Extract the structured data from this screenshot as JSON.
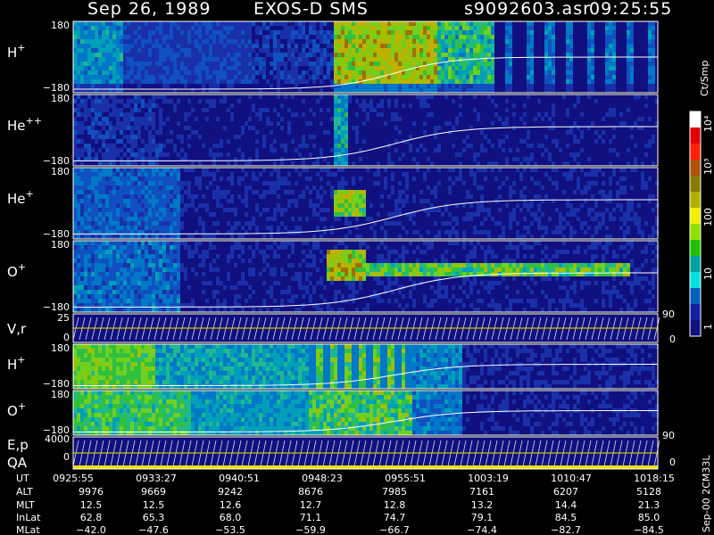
{
  "header": {
    "date": "Sep 26, 1989",
    "instrument": "EXOS-D SMS",
    "filename": "s9092603.asr",
    "time": "09:25:55"
  },
  "panels": [
    {
      "label": "H+",
      "species": "H",
      "charge": "+",
      "top_tick": "180",
      "bottom_tick": "−180"
    },
    {
      "label": "He++",
      "species": "He",
      "charge": "++",
      "top_tick": "180",
      "bottom_tick": "−180"
    },
    {
      "label": "He+",
      "species": "He",
      "charge": "+",
      "top_tick": "180",
      "bottom_tick": "−180"
    },
    {
      "label": "O+",
      "species": "O",
      "charge": "+",
      "top_tick": "180",
      "bottom_tick": "−180"
    }
  ],
  "vr_panel": {
    "label": "V,r",
    "top_tick": "25",
    "bottom_tick": "0",
    "right_top": "90",
    "right_bottom": "0"
  },
  "lower_panels": [
    {
      "label": "H+",
      "species": "H",
      "charge": "+",
      "top_tick": "180",
      "bottom_tick": "−180"
    },
    {
      "label": "O+",
      "species": "O",
      "charge": "+",
      "top_tick": "180",
      "bottom_tick": "−180"
    }
  ],
  "ep_panel": {
    "label1": "E,p",
    "label2": "QA",
    "top_tick": "4000",
    "bottom_tick": "0",
    "right_top": "90",
    "right_bottom": "0"
  },
  "colorbar": {
    "unit": "Ct/Smp",
    "ticks": [
      "10⁴",
      "10³",
      "100",
      "10",
      "1"
    ],
    "colors": [
      "#ffffff",
      "#e00000",
      "#ff2000",
      "#b05000",
      "#8a7a00",
      "#b0b000",
      "#f0f000",
      "#90e000",
      "#20c000",
      "#00a0a0",
      "#00e0e0",
      "#0060c0",
      "#1020a0",
      "#101080"
    ]
  },
  "side_note": "Sep-00 2CM33L",
  "orbit_table": {
    "row_labels": [
      "UT",
      "ALT",
      "MLT",
      "InLat",
      "MLat"
    ],
    "columns": [
      [
        "0925:55",
        "9976",
        "12.5",
        "62.8",
        "−42.0"
      ],
      [
        "0933:27",
        "9669",
        "12.5",
        "65.3",
        "−47.6"
      ],
      [
        "0940:51",
        "9242",
        "12.6",
        "68.0",
        "−53.5"
      ],
      [
        "0948:23",
        "8676",
        "12.7",
        "71.1",
        "−59.9"
      ],
      [
        "0955:51",
        "7985",
        "12.8",
        "74.7",
        "−66.7"
      ],
      [
        "1003:19",
        "7161",
        "13.2",
        "79.1",
        "−74.4"
      ],
      [
        "1010:47",
        "6207",
        "14.4",
        "84.5",
        "−82.7"
      ],
      [
        "1018:15",
        "5128",
        "21.3",
        "85.0",
        "−84.5"
      ]
    ]
  },
  "chart_data": {
    "type": "heatmap",
    "x_axis_ticks": [
      "0925:55",
      "0933:27",
      "0940:51",
      "0948:23",
      "0955:51",
      "1003:19",
      "1010:47",
      "1018:15"
    ],
    "y_range_pitch_panels": [
      -180,
      180
    ],
    "colorbar_range": [
      1,
      10000
    ],
    "colorbar_scale": "log",
    "colorbar_unit": "Ct/Smp"
  }
}
